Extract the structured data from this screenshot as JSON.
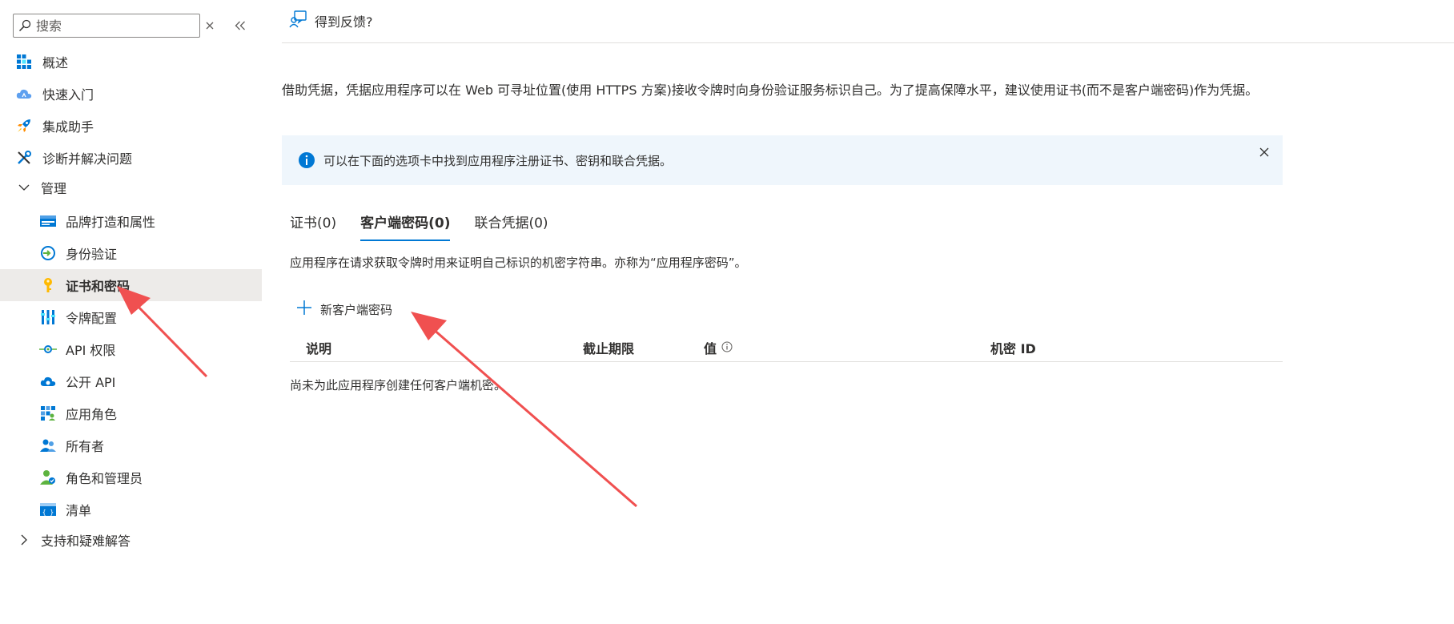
{
  "sidebar": {
    "search_placeholder": "搜索",
    "items": [
      {
        "label": "概述"
      },
      {
        "label": "快速入门"
      },
      {
        "label": "集成助手"
      },
      {
        "label": "诊断并解决问题"
      },
      {
        "label": "管理"
      },
      {
        "label": "品牌打造和属性"
      },
      {
        "label": "身份验证"
      },
      {
        "label": "证书和密码"
      },
      {
        "label": "令牌配置"
      },
      {
        "label": "API 权限"
      },
      {
        "label": "公开 API"
      },
      {
        "label": "应用角色"
      },
      {
        "label": "所有者"
      },
      {
        "label": "角色和管理员"
      },
      {
        "label": "清单"
      },
      {
        "label": "支持和疑难解答"
      }
    ]
  },
  "header": {
    "feedback_label": "得到反馈?"
  },
  "main": {
    "description": "借助凭据，凭据应用程序可以在 Web 可寻址位置(使用 HTTPS 方案)接收令牌时向身份验证服务标识自己。为了提高保障水平，建议使用证书(而不是客户端密码)作为凭据。",
    "info_text": "可以在下面的选项卡中找到应用程序注册证书、密钥和联合凭据。",
    "tabs": [
      {
        "label": "证书(0)"
      },
      {
        "label": "客户端密码(0)"
      },
      {
        "label": "联合凭据(0)"
      }
    ],
    "tab_description": "应用程序在请求获取令牌时用来证明自己标识的机密字符串。亦称为“应用程序密码”。",
    "add_button": "新客户端密码",
    "table": {
      "columns": [
        "说明",
        "截止期限",
        "值",
        "机密 ID"
      ],
      "empty_message": "尚未为此应用程序创建任何客户端机密。"
    }
  },
  "colors": {
    "accent": "#0078d4",
    "selected_bg": "#edebe9",
    "info_bg": "#eff6fc",
    "annotation_arrow": "#f05050"
  }
}
